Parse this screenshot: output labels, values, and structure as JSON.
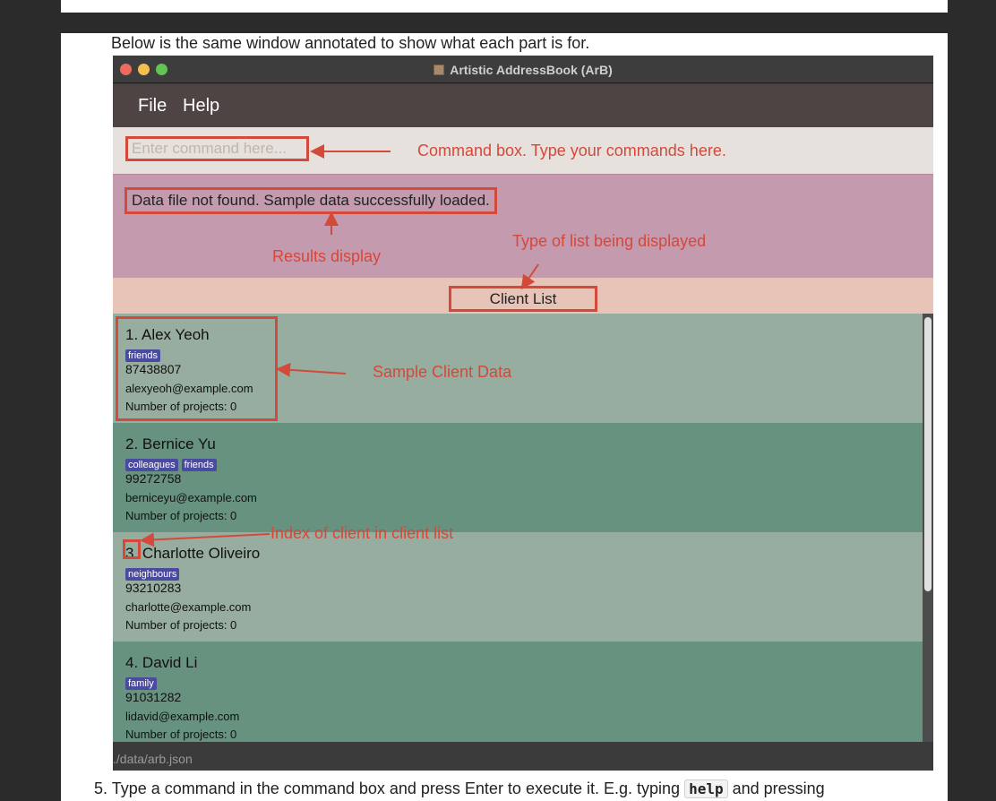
{
  "doc": {
    "intro": "Below is the same window annotated to show what each part is for.",
    "step_number": "5.",
    "step_before": "Type a command in the command box and press Enter to execute it. E.g. typing",
    "step_code": "help",
    "step_after": "and pressing"
  },
  "window": {
    "title": "Artistic AddressBook (ArB)",
    "menu": {
      "file": "File",
      "help": "Help"
    },
    "command_placeholder": "Enter command here...",
    "result_text": "Data file not found. Sample data successfully loaded.",
    "list_title": "Client List",
    "status_path": "./data/arb.json"
  },
  "clients": [
    {
      "index": "1.",
      "name": "Alex Yeoh",
      "tags": [
        "friends"
      ],
      "phone": "87438807",
      "email": "alexyeoh@example.com",
      "projects": "Number of projects: 0"
    },
    {
      "index": "2.",
      "name": "Bernice Yu",
      "tags": [
        "colleagues",
        "friends"
      ],
      "phone": "99272758",
      "email": "berniceyu@example.com",
      "projects": "Number of projects: 0"
    },
    {
      "index": "3.",
      "name": "Charlotte Oliveiro",
      "tags": [
        "neighbours"
      ],
      "phone": "93210283",
      "email": "charlotte@example.com",
      "projects": "Number of projects: 0"
    },
    {
      "index": "4.",
      "name": "David Li",
      "tags": [
        "family"
      ],
      "phone": "91031282",
      "email": "lidavid@example.com",
      "projects": "Number of projects: 0"
    }
  ],
  "annotations": {
    "command_box": "Command box. Type your commands here.",
    "results_display": "Results display",
    "list_type": "Type of list being displayed",
    "sample_data": "Sample Client Data",
    "index": "Index of client in client list"
  },
  "colors": {
    "annotation": "#d34a3a",
    "menubar": "#4f4444",
    "results_bg": "#c49aae",
    "list_header_bg": "#e8c3b7",
    "card_light": "#96ad9f",
    "card_dark": "#66927f",
    "tag": "#4a4aa0"
  }
}
